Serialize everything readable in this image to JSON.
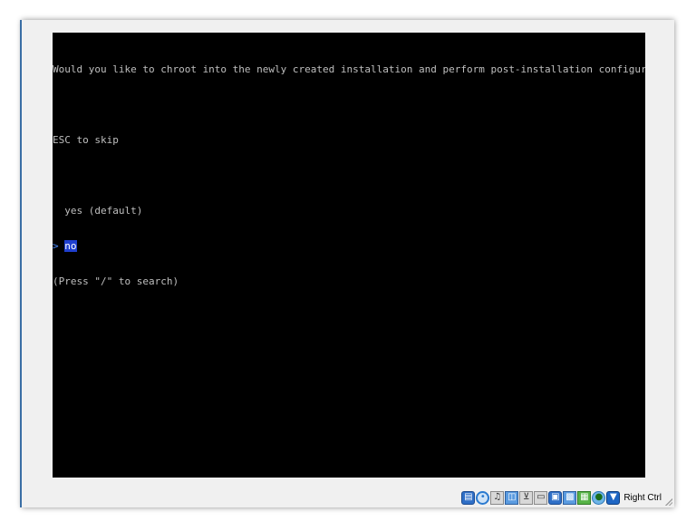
{
  "terminal": {
    "prompt_question": "Would you like to chroot into the newly created installation and perform post-installation configura",
    "skip_hint": "ESC to skip",
    "options": [
      {
        "label": "yes (default)",
        "selected": false
      },
      {
        "label": "no",
        "selected": true
      }
    ],
    "cursor_glyph": ">",
    "search_hint": "(Press \"/\" to search)"
  },
  "statusbar": {
    "icons": [
      "hard-disk-icon",
      "optical-drive-icon",
      "audio-icon",
      "network-icon",
      "usb-icon",
      "shared-folders-icon",
      "display-icon",
      "video-capture-icon",
      "cpu-icon",
      "mouse-integration-icon",
      "keyboard-capture-icon"
    ],
    "host_key_label": "Right Ctrl"
  },
  "colors": {
    "terminal_background": "#000000",
    "terminal_text": "#bfbfbf",
    "selection_background": "#1f3fcf",
    "cursor_glyph": "#4a8cff"
  }
}
